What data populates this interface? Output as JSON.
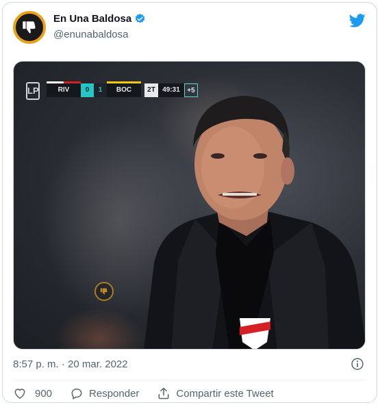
{
  "tweet": {
    "author": {
      "display_name": "En Una Baldosa",
      "handle": "@enunabaldosa",
      "verified": true,
      "avatar_icon": "thumbs-down-icon",
      "avatar_border_color": "#e9a21f"
    },
    "platform_icon": "twitter-bird-icon",
    "brand_color": "#1d9bf0",
    "media": {
      "scoreboard": {
        "home_team": "RIV",
        "home_score": "0",
        "away_score": "1",
        "away_team": "BOC",
        "half": "2T",
        "clock": "49:31",
        "added_time": "+5"
      }
    },
    "timestamp": "8:57 p. m. · 20 mar. 2022",
    "actions": {
      "likes": "900",
      "reply_label": "Responder",
      "share_label": "Compartir este Tweet"
    }
  }
}
